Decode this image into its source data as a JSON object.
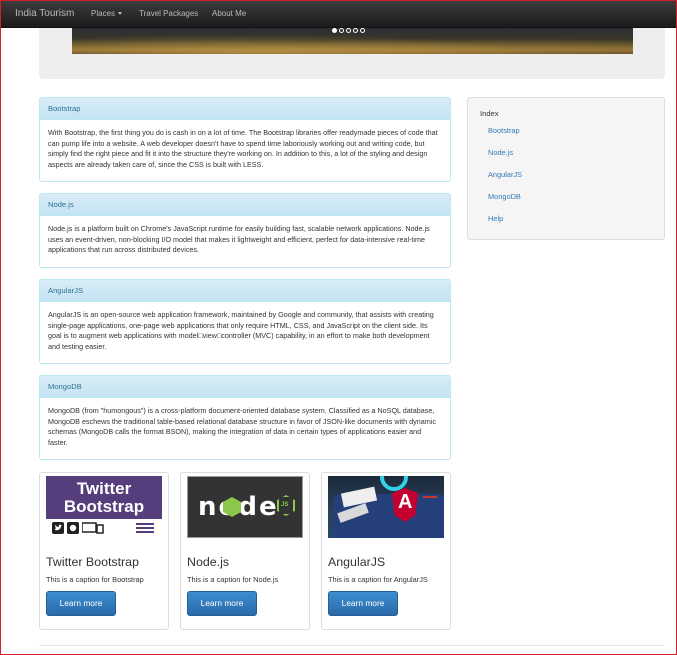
{
  "navbar": {
    "brand": "India Tourism",
    "items": [
      {
        "label": "Places",
        "dropdown": true
      },
      {
        "label": "Travel Packages",
        "dropdown": false
      },
      {
        "label": "About Me",
        "dropdown": false
      }
    ]
  },
  "carousel": {
    "indicator_count": 5,
    "active_index": 0
  },
  "panels": [
    {
      "title": "Bootstrap",
      "body": "With Bootstrap, the first thing you do is cash in on a lot of time. The Bootstrap libraries offer readymade pieces of code that can pump life into a website. A web developer doesn't have to spend time laboriously working out and writing code, but simply find the right piece and fit it into the structure they're working on. In addition to this, a lot of the styling and design aspects are already taken care of, since the CSS is built with LESS."
    },
    {
      "title": "Node.js",
      "body": "Node.js is a platform built on Chrome's JavaScript runtime for easily building fast, scalable network applications. Node.js uses an event-driven, non-blocking I/O model that makes it lightweight and efficient, perfect for data-intensive real-time applications that run across distributed devices."
    },
    {
      "title": "AngularJS",
      "body": "AngularJS is an open-source web application framework, maintained by Google and community, that assists with creating single-page applications, one-page web applications that only require HTML, CSS, and JavaScript on the client side. Its goal is to augment web applications with model□view□controller (MVC) capability, in an effort to make both development and testing easier."
    },
    {
      "title": "MongoDB",
      "body": "MongoDB (from \"humongous\") is a cross-platform document-oriented database system. Classified as a NoSQL database, MongoDB eschews the traditional table-based relational database structure in favor of JSON-like documents with dynamic schemas (MongoDB calls the format BSON), making the integration of data in certain types of applications easier and faster."
    }
  ],
  "sidebar": {
    "title": "Index",
    "links": [
      "Bootstrap",
      "Node.js",
      "AngularJS",
      "MongoDB",
      "Help"
    ]
  },
  "thumbnails": [
    {
      "image_text_1": "Twitter",
      "image_text_2": "Bootstrap",
      "title": "Twitter Bootstrap",
      "caption": "This is a caption for Bootstrap",
      "button": "Learn more"
    },
    {
      "image_text_1": "node",
      "image_text_2": "JS",
      "title": "Node.js",
      "caption": "This is a caption for Node.js",
      "button": "Learn more"
    },
    {
      "image_text_1": "A",
      "image_text_2": "",
      "title": "AngularJS",
      "caption": "This is a caption for AngularJS",
      "button": "Learn more"
    }
  ],
  "colors": {
    "navbar_bg": "#222222",
    "panel_heading_bg": "#d9edf7",
    "panel_heading_text": "#31708f",
    "link": "#337ab7",
    "button_primary": "#337ab7",
    "window_border": "#d21f2b"
  }
}
